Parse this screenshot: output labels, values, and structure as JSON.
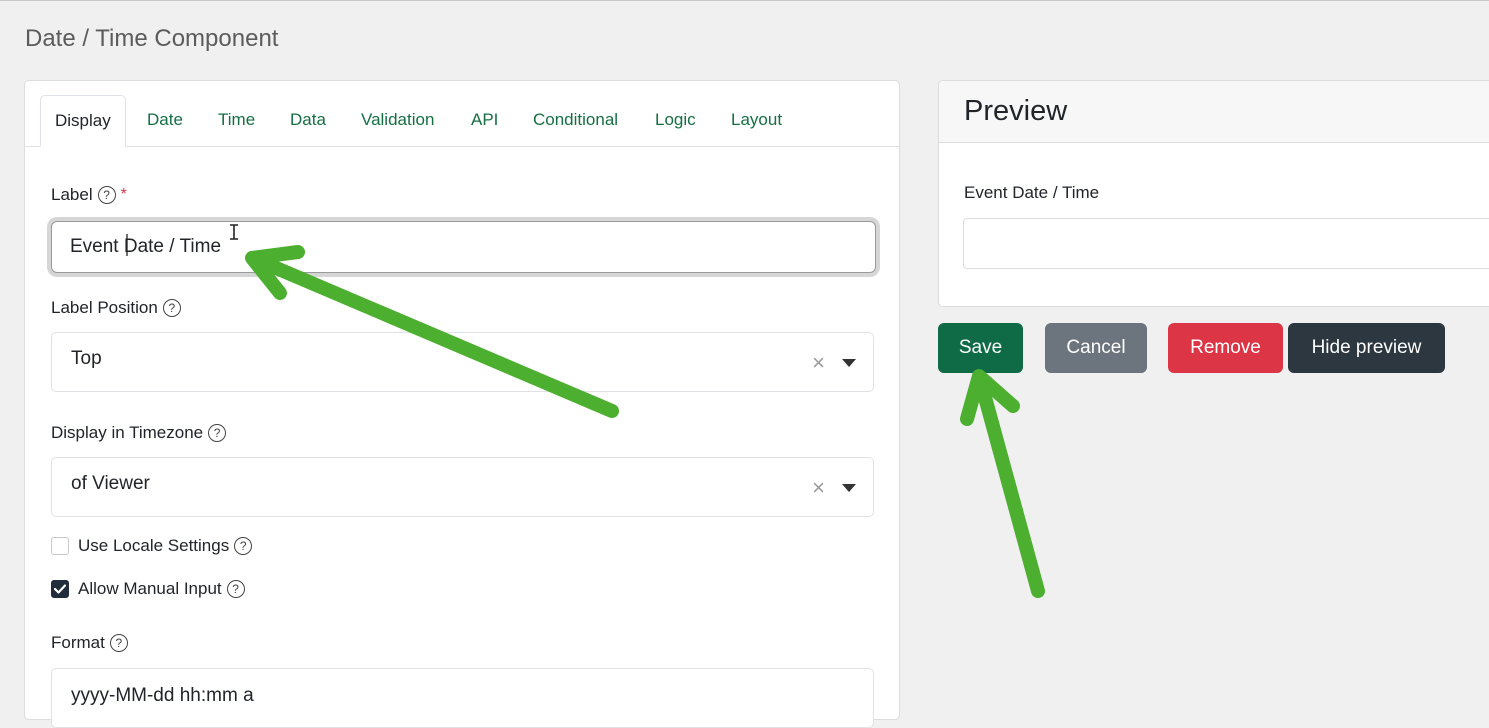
{
  "page": {
    "title": "Date / Time Component"
  },
  "tabs": [
    "Display",
    "Date",
    "Time",
    "Data",
    "Validation",
    "API",
    "Conditional",
    "Logic",
    "Layout"
  ],
  "fields": {
    "label": {
      "label": "Label",
      "value": "Event Date / Time",
      "required_mark": "*"
    },
    "label_position": {
      "label": "Label Position",
      "value": "Top",
      "clear": "×"
    },
    "timezone": {
      "label": "Display in Timezone",
      "value": "of Viewer",
      "clear": "×"
    },
    "use_locale": {
      "label": "Use Locale Settings",
      "checked": false
    },
    "allow_manual": {
      "label": "Allow Manual Input",
      "checked": true
    },
    "format": {
      "label": "Format",
      "value": "yyyy-MM-dd hh:mm a"
    },
    "help": "?"
  },
  "preview": {
    "title": "Preview",
    "field_label": "Event Date / Time"
  },
  "buttons": {
    "save": "Save",
    "cancel": "Cancel",
    "remove": "Remove",
    "hide_preview": "Hide preview"
  },
  "colors": {
    "tab_link": "#156f43",
    "save": "#0f6b46",
    "cancel": "#6c757d",
    "remove": "#dc3545",
    "hide": "#2d3740",
    "annotation_arrow": "#4caf2f"
  }
}
